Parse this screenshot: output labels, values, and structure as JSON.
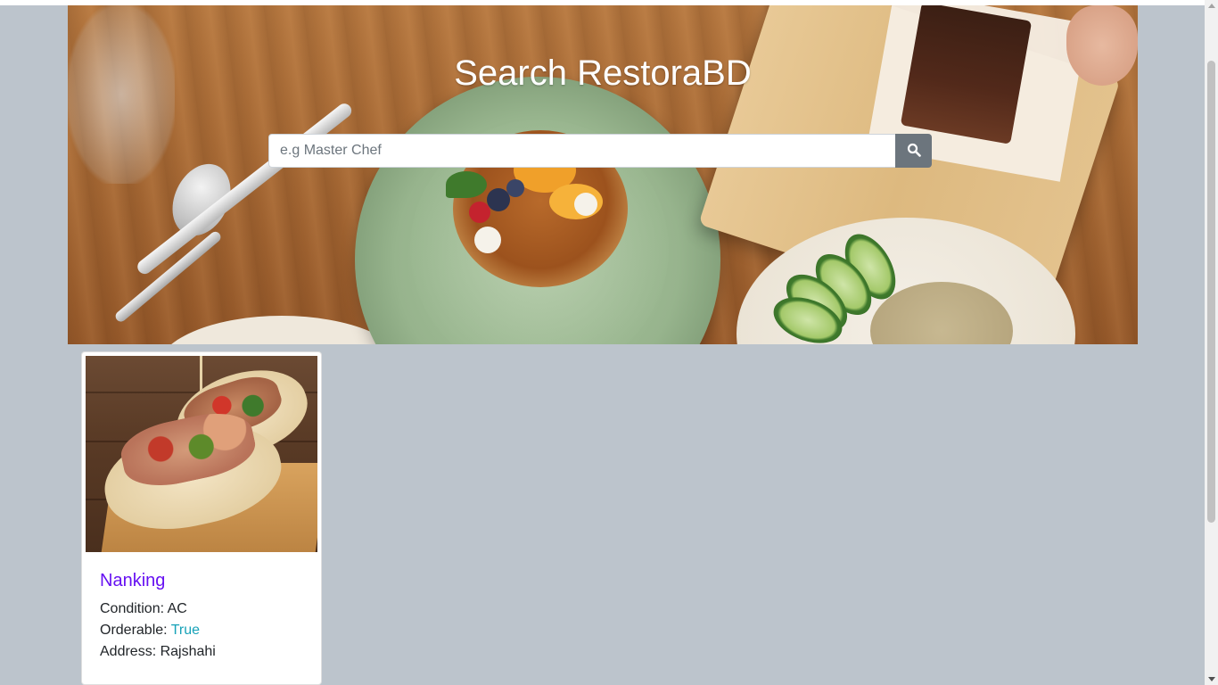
{
  "hero": {
    "title": "Search RestoraBD",
    "search": {
      "placeholder": "e.g Master Chef",
      "value": "",
      "button_icon": "search-icon"
    }
  },
  "results": [
    {
      "name": "Nanking",
      "image_icon": "food-photo",
      "condition_label": "Condition: ",
      "condition_value": "AC",
      "orderable_label": "Orderable: ",
      "orderable_value": "True",
      "address_label": "Address: ",
      "address_value": "Rajshahi"
    }
  ],
  "colors": {
    "page_background": "#bcc4cc",
    "title_link": "#6610f2",
    "orderable_value": "#17a2b8",
    "search_button": "#6c757d"
  }
}
